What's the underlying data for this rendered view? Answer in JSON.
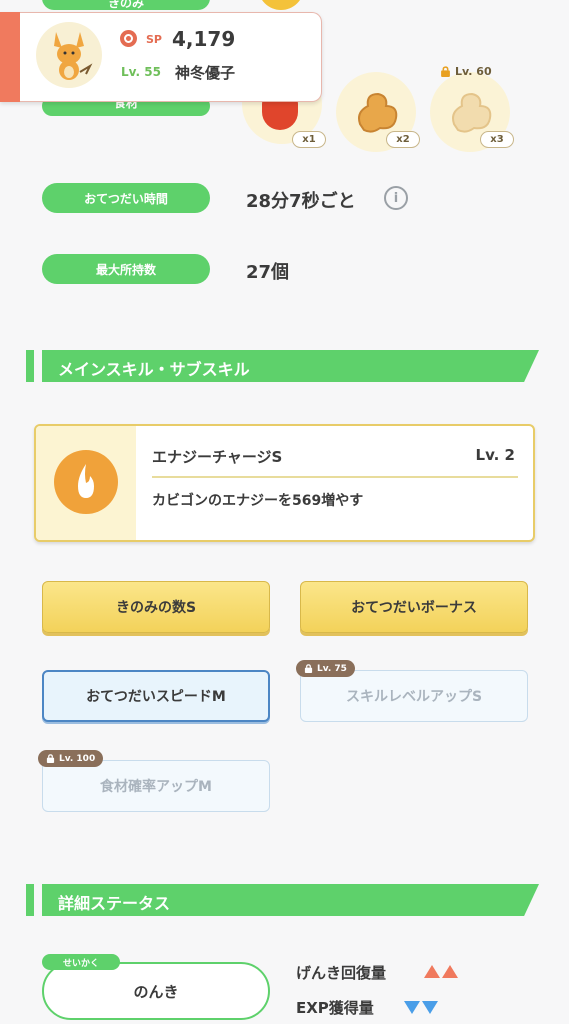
{
  "top_labels": {
    "berry_label": "きのみ",
    "ingredient_label": "食材"
  },
  "pokemon_card": {
    "sp_label": "SP",
    "sp_value": "4,179",
    "level_label": "Lv. 55",
    "nickname": "神冬優子"
  },
  "ingredients": [
    {
      "name": "tomato",
      "count": "x1",
      "locked": false
    },
    {
      "name": "ginger",
      "count": "x2",
      "locked": false
    },
    {
      "name": "ginger",
      "count": "x3",
      "locked": true,
      "lock_level": "Lv. 60"
    }
  ],
  "stats": {
    "help_time_label": "おてつだい時間",
    "help_time_value": "28分7秒ごと",
    "max_carry_label": "最大所持数",
    "max_carry_value": "27個"
  },
  "skill_section": {
    "title": "メインスキル・サブスキル",
    "main_skill": {
      "name": "エナジーチャージS",
      "level": "Lv. 2",
      "description": "カビゴンのエナジーを569増やす"
    },
    "sub_skills": [
      {
        "label": "きのみの数S",
        "style": "gold",
        "locked": false
      },
      {
        "label": "おてつだいボーナス",
        "style": "gold",
        "locked": false
      },
      {
        "label": "おてつだいスピードM",
        "style": "blue",
        "locked": false
      },
      {
        "label": "スキルレベルアップS",
        "style": "disabled",
        "locked": true,
        "lock_level": "Lv. 75"
      },
      {
        "label": "食材確率アップM",
        "style": "disabled",
        "locked": true,
        "lock_level": "Lv. 100"
      }
    ]
  },
  "detail_section": {
    "title": "詳細ステータス",
    "nature_tag": "せいかく",
    "nature": "のんき",
    "effects": [
      {
        "label": "げんき回復量",
        "direction": "up",
        "color": "#f07a5e"
      },
      {
        "label": "EXP獲得量",
        "direction": "down",
        "color": "#4a9ee8"
      }
    ]
  },
  "colors": {
    "accent_green": "#5ed16b",
    "card_red": "#f07a5e",
    "gold": "#f3d25a",
    "blue_border": "#4c86c4"
  }
}
